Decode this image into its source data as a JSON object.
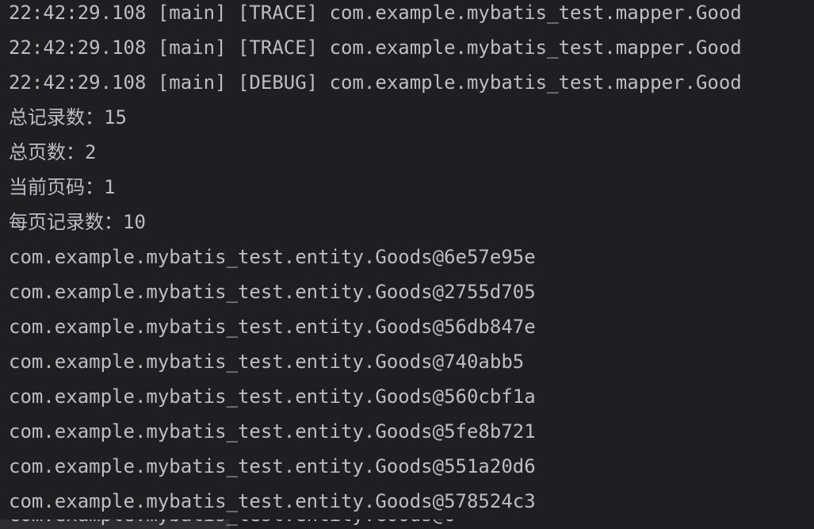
{
  "console": {
    "lines": [
      "22:42:29.108 [main] [TRACE] com.example.mybatis_test.mapper.Good",
      "22:42:29.108 [main] [TRACE] com.example.mybatis_test.mapper.Good",
      "22:42:29.108 [main] [DEBUG] com.example.mybatis_test.mapper.Good",
      "总记录数：15",
      "总页数：2",
      "当前页码：1",
      "每页记录数：10",
      "com.example.mybatis_test.entity.Goods@6e57e95e",
      "com.example.mybatis_test.entity.Goods@2755d705",
      "com.example.mybatis_test.entity.Goods@56db847e",
      "com.example.mybatis_test.entity.Goods@740abb5",
      "com.example.mybatis_test.entity.Goods@560cbf1a",
      "com.example.mybatis_test.entity.Goods@5fe8b721",
      "com.example.mybatis_test.entity.Goods@551a20d6",
      "com.example.mybatis_test.entity.Goods@578524c3"
    ],
    "partial_line": "com.example.mybatis_test.entity.Goods@6"
  },
  "colors": {
    "background": "#1e1f22",
    "text": "#bcbec4"
  }
}
